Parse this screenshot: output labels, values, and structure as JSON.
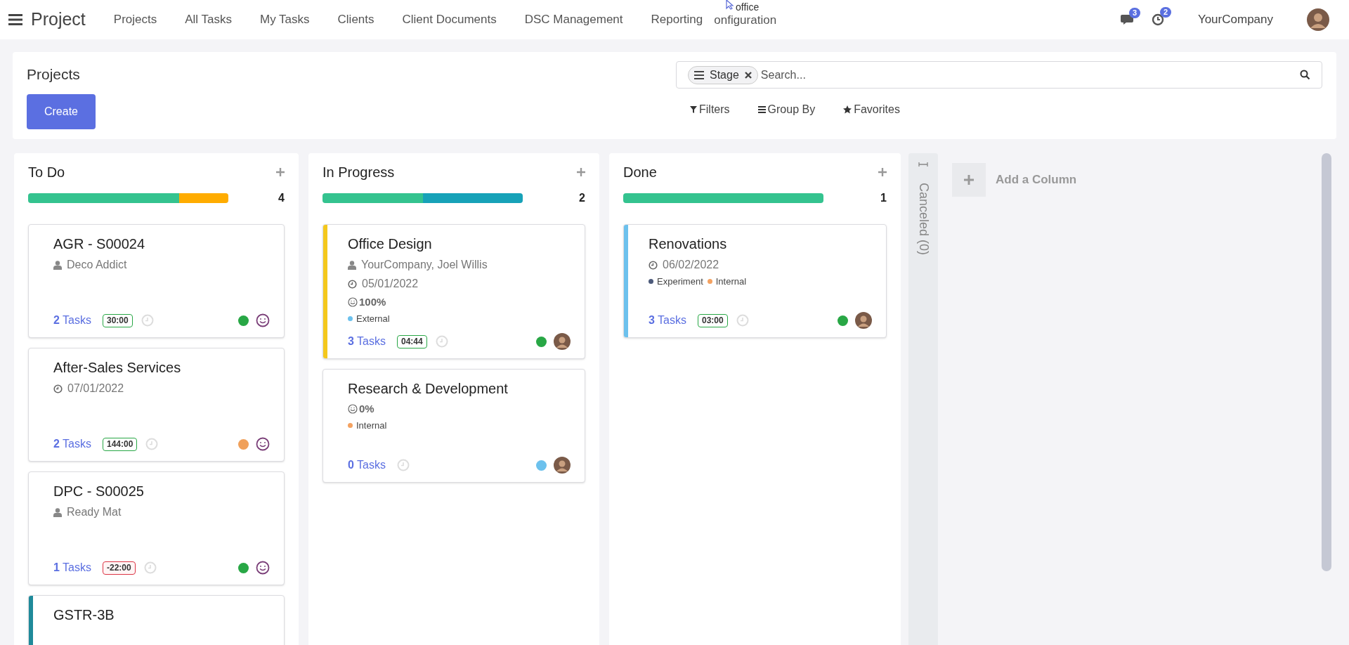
{
  "app_title": "Project",
  "nav": [
    "Projects",
    "All Tasks",
    "My Tasks",
    "Clients",
    "Client Documents",
    "DSC Management",
    "Reporting",
    "onfiguration"
  ],
  "tooltip": "office",
  "notifications": [
    {
      "kind": "chat",
      "count": "3"
    },
    {
      "kind": "activity",
      "count": "2"
    }
  ],
  "company": "YourCompany",
  "control_panel": {
    "title": "Projects",
    "create": "Create",
    "facet": "Stage",
    "placeholder": "Search...",
    "filters": [
      "Filters",
      "Group By",
      "Favorites"
    ]
  },
  "columns": [
    {
      "title": "To Do",
      "count": "4",
      "progress": [
        {
          "color": "#34c38f",
          "level": 0.755
        },
        {
          "color": "#ffac00",
          "level": 0.245
        }
      ],
      "cards": [
        {
          "title": "AGR - S00024",
          "kind": "smiley",
          "lines": [
            {
              "kind": "partner",
              "text": "Deco Addict"
            }
          ],
          "tasks": "**2** Tasks",
          "time": "30:00",
          "overdue": false,
          "status": {
            "color": "#28a745"
          }
        },
        {
          "title": "After-Sales Services",
          "kind": "smiley",
          "lines": [
            {
              "kind": "date",
              "text": "07/01/2022"
            }
          ],
          "tasks": "**2** Tasks",
          "time": "144:00",
          "overdue": false,
          "status": {
            "color": "#f0a05a"
          }
        },
        {
          "title": "DPC - S00025",
          "kind": "smiley",
          "lines": [
            {
              "kind": "partner",
              "text": "Ready Mat"
            }
          ],
          "tasks": "**1** Tasks",
          "time": "-22:00",
          "overdue": true,
          "status": {
            "color": "#28a745"
          }
        },
        {
          "title": "GSTR-3B",
          "accent": {
            "color": "#1f8a9a"
          }
        }
      ]
    },
    {
      "title": "In Progress",
      "count": "2",
      "progress": [
        {
          "color": "#34c38f",
          "level": 0.5
        },
        {
          "color": "#17a2b8",
          "level": 0.5
        }
      ],
      "cards": [
        {
          "title": "Office Design",
          "kind": "photo",
          "accent": {
            "color": "#f4c81c"
          },
          "lines": [
            {
              "kind": "partner",
              "text": "YourCompany, Joel Willis"
            },
            {
              "kind": "date",
              "text": "05/01/2022"
            },
            {
              "kind": "rating",
              "text": "100%"
            },
            {
              "kind": "tags",
              "tags": [
                {
                  "text": "External",
                  "color": "#6cc1ed"
                }
              ]
            }
          ],
          "tasks": "**3** Tasks",
          "time": "04:44",
          "overdue": false,
          "status": {
            "color": "#28a745"
          }
        },
        {
          "title": "Research & Development",
          "kind": "photo",
          "lines": [
            {
              "kind": "rating",
              "text": "0%"
            },
            {
              "kind": "tags",
              "tags": [
                {
                  "text": "Internal",
                  "color": "#f4a261"
                }
              ]
            }
          ],
          "tasks": "**0** Tasks",
          "status": {
            "color": "#6cc1ed"
          }
        }
      ]
    },
    {
      "title": "Done",
      "count": "1",
      "progress": [
        {
          "color": "#34c38f",
          "level": 1
        }
      ],
      "cards": [
        {
          "title": "Renovations",
          "kind": "photo",
          "accent": {
            "color": "#6cc1ed"
          },
          "lines": [
            {
              "kind": "date",
              "text": "06/02/2022"
            },
            {
              "kind": "tags",
              "tags": [
                {
                  "text": "Experiment",
                  "color": "#4c5a7a"
                },
                {
                  "text": "Internal",
                  "color": "#f4a261"
                }
              ]
            }
          ],
          "tasks": "**3** Tasks",
          "time": "03:00",
          "overdue": false,
          "status": {
            "color": "#28a745"
          }
        }
      ]
    }
  ],
  "folded_column": "Canceled (0)",
  "add_column": "Add a Column"
}
